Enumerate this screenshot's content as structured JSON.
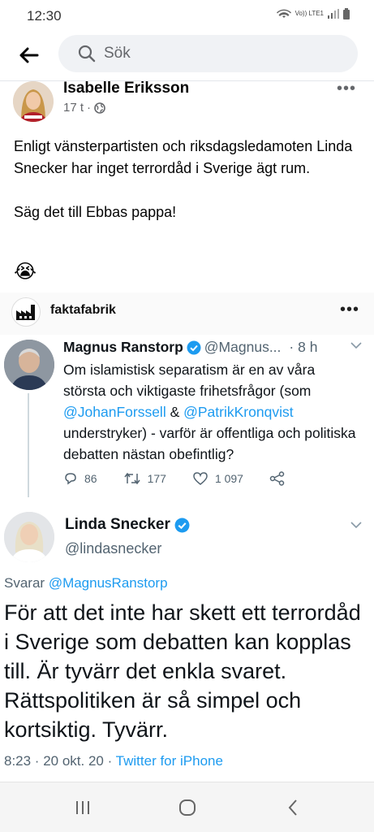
{
  "status_bar": {
    "time": "12:30",
    "network_label": "Vo)) LTE1"
  },
  "top_bar": {
    "search_placeholder": "Sök"
  },
  "post": {
    "author": "Isabelle Eriksson",
    "time": "17 t",
    "text_paragraphs": [
      "Enligt vänsterpartisten och riksdagsledamoten Linda Snecker har inget terrordåd i Sverige ägt rum.",
      "Säg det till Ebbas pappa!"
    ],
    "emoji": "😭"
  },
  "shared_image": {
    "source_name": "faktafabrik",
    "tweet1": {
      "name": "Magnus Ranstorp",
      "handle": "@Magnus...",
      "time": "· 8 h",
      "text_parts": [
        {
          "t": "Om islamistisk separatism är en av våra största och viktigaste frihetsfrågor (som ",
          "m": false
        },
        {
          "t": "@JohanForssell",
          "m": true
        },
        {
          "t": " & ",
          "m": false
        },
        {
          "t": "@PatrikKronqvist",
          "m": true
        },
        {
          "t": " understryker) - varför är offentliga och politiska debatten nästan obefintlig?",
          "m": false
        }
      ],
      "replies": "86",
      "retweets": "177",
      "likes": "1 097"
    },
    "tweet2": {
      "name": "Linda Snecker",
      "handle": "@lindasnecker",
      "reply_label": "Svarar",
      "reply_to": "@MagnusRanstorp",
      "text": "För att det inte har skett ett terrordåd i Sverige som debatten kan kopplas till. Är tyvärr det enkla svaret. Rättspolitiken är så simpel och kortsiktig. Tyvärr.",
      "date": "8:23 · 20 okt. 20 · ",
      "source": "Twitter for iPhone"
    }
  },
  "colors": {
    "twitter_blue": "#1d9bf0",
    "fb_gray": "#65676b",
    "verified": "#1d9bf0"
  }
}
